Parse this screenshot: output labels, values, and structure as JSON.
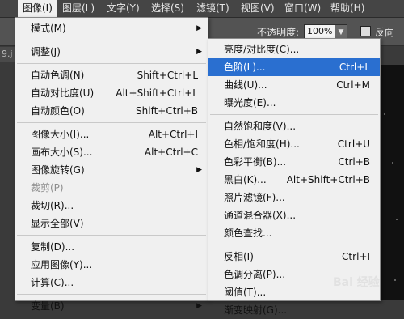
{
  "menubar": {
    "items": [
      {
        "label": "图像(I)"
      },
      {
        "label": "图层(L)"
      },
      {
        "label": "文字(Y)"
      },
      {
        "label": "选择(S)"
      },
      {
        "label": "滤镜(T)"
      },
      {
        "label": "视图(V)"
      },
      {
        "label": "窗口(W)"
      },
      {
        "label": "帮助(H)"
      }
    ]
  },
  "options_bar": {
    "opacity_label": "不透明度:",
    "opacity_value": "100%",
    "reverse_label": "反向",
    "dropdown_icon": "chevron-down-icon"
  },
  "doc_tab_label": "9.j",
  "image_menu": {
    "items": [
      {
        "label": "模式(M)",
        "submenu": true
      },
      {
        "label": "调整(J)",
        "submenu": true
      },
      {
        "label": "自动色调(N)",
        "shortcut": "Shift+Ctrl+L"
      },
      {
        "label": "自动对比度(U)",
        "shortcut": "Alt+Shift+Ctrl+L"
      },
      {
        "label": "自动颜色(O)",
        "shortcut": "Shift+Ctrl+B"
      },
      {
        "label": "图像大小(I)...",
        "shortcut": "Alt+Ctrl+I"
      },
      {
        "label": "画布大小(S)...",
        "shortcut": "Alt+Ctrl+C"
      },
      {
        "label": "图像旋转(G)",
        "submenu": true
      },
      {
        "label": "裁剪(P)",
        "disabled": true
      },
      {
        "label": "裁切(R)..."
      },
      {
        "label": "显示全部(V)"
      },
      {
        "label": "复制(D)..."
      },
      {
        "label": "应用图像(Y)..."
      },
      {
        "label": "计算(C)..."
      },
      {
        "label": "变量(B)",
        "submenu": true
      }
    ]
  },
  "adjust_menu": {
    "items": [
      {
        "label": "亮度/对比度(C)..."
      },
      {
        "label": "色阶(L)...",
        "shortcut": "Ctrl+L",
        "highlighted": true
      },
      {
        "label": "曲线(U)...",
        "shortcut": "Ctrl+M"
      },
      {
        "label": "曝光度(E)..."
      },
      {
        "label": "自然饱和度(V)..."
      },
      {
        "label": "色相/饱和度(H)...",
        "shortcut": "Ctrl+U"
      },
      {
        "label": "色彩平衡(B)...",
        "shortcut": "Ctrl+B"
      },
      {
        "label": "黑白(K)...",
        "shortcut": "Alt+Shift+Ctrl+B"
      },
      {
        "label": "照片滤镜(F)..."
      },
      {
        "label": "通道混合器(X)..."
      },
      {
        "label": "颜色查找..."
      },
      {
        "label": "反相(I)",
        "shortcut": "Ctrl+I"
      },
      {
        "label": "色调分离(P)..."
      },
      {
        "label": "阈值(T)..."
      },
      {
        "label": "渐变映射(G)..."
      }
    ]
  },
  "watermark": "Bai 经验",
  "colors": {
    "menubar_bg": "#454545",
    "menu_bg": "#f0f0f0",
    "highlight": "#2a6fd0"
  }
}
